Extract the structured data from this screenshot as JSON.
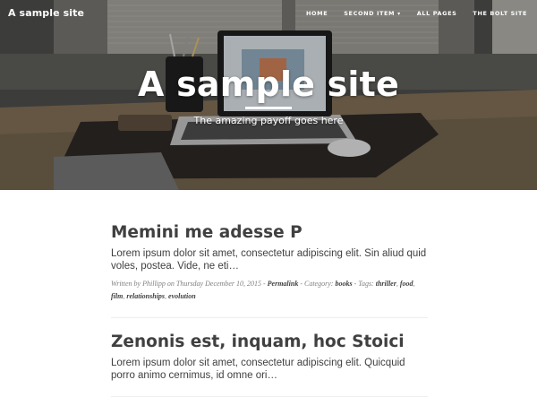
{
  "brand": "A sample site",
  "nav": {
    "items": [
      {
        "label": "HOME"
      },
      {
        "label": "SECOND ITEM",
        "caret": "▾"
      },
      {
        "label": "ALL PAGES"
      },
      {
        "label": "THE BOLT SITE"
      }
    ]
  },
  "hero": {
    "heading": "A sample site",
    "subheading": "The amazing payoff goes here"
  },
  "posts": [
    {
      "title": "Memini me adesse P",
      "excerpt": "Lorem ipsum dolor sit amet, consectetur adipiscing elit. Sin aliud quid voles, postea. Vide, ne eti…",
      "meta": {
        "written_by": "Written by Phillipp on Thursday December 10, 2015 -",
        "permalink": "Permalink",
        "category_prefix": "- Category:",
        "category": "books",
        "tags_prefix": "- Tags:",
        "tags": [
          "thriller",
          "food",
          "film",
          "relationships",
          "evolution"
        ]
      }
    },
    {
      "title": "Zenonis est, inquam, hoc Stoici",
      "excerpt": "Lorem ipsum dolor sit amet, consectetur adipiscing elit. Quicquid porro animo cernimus, id omne ori…"
    }
  ]
}
